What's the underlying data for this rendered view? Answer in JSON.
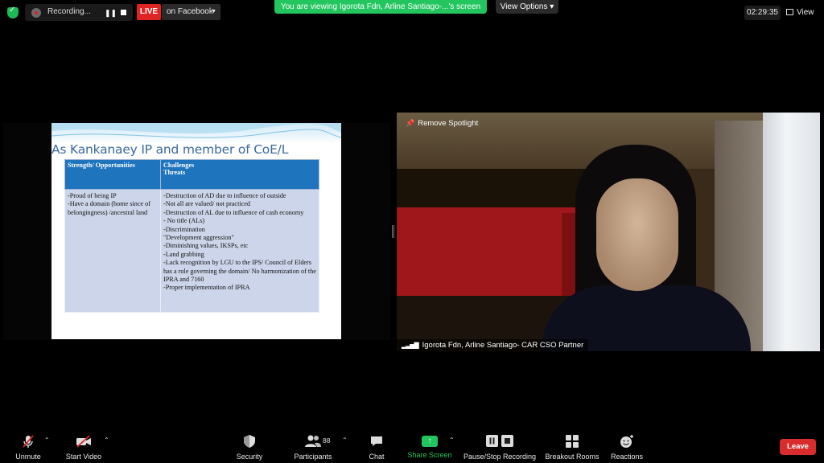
{
  "topbar": {
    "recording_label": "Recording...",
    "pause_icon": "❚❚",
    "live_label": "LIVE",
    "facebook_label": "on Facebook",
    "viewing_banner": "You are viewing  Igorota Fdn, Arline Santiago-...'s screen",
    "view_options_label": "View Options ▾",
    "timer": "02:29:35",
    "view_label": "View"
  },
  "slide": {
    "title": "As Kankanaey IP and  member of CoE/L",
    "col1_header": "Strength/ Opportunities",
    "col2_header_line1": "Challenges",
    "col2_header_line2": "Threats",
    "col1_items": [
      "-Proud of being IP",
      "-Have a domain (home since of belongingness) /ancestral land"
    ],
    "col2_items": [
      "-Destruction of AD due to influence of outside",
      "-Not all are valued/ not practiced",
      "-Destruction of AL due to influence of cash economy",
      "- No title (ALs)",
      "-Discrimination",
      "\"Development aggression\"",
      "-Diminishing values, IKSPs, etc",
      "-Land grabbing",
      "-Lack recognition  by LGU to the IPS/ Council of Elders has  a role governing the domain/ No harmonization of the   IPRA and 7160",
      "-Proper implementation of IPRA"
    ]
  },
  "video": {
    "remove_spotlight": "Remove Spotlight",
    "participant_name": "Igorota Fdn, Arline Santiago- CAR CSO Partner"
  },
  "toolbar": {
    "unmute": "Unmute",
    "start_video": "Start Video",
    "security": "Security",
    "participants": "Participants",
    "participants_count": "88",
    "chat": "Chat",
    "share_screen": "Share Screen",
    "pause_stop_recording": "Pause/Stop Recording",
    "breakout_rooms": "Breakout Rooms",
    "reactions": "Reactions",
    "leave": "Leave"
  },
  "colors": {
    "live_red": "#e02424",
    "banner_green": "#22c55e",
    "leave_red": "#d92c2c",
    "slide_header_blue": "#1e74bd"
  }
}
